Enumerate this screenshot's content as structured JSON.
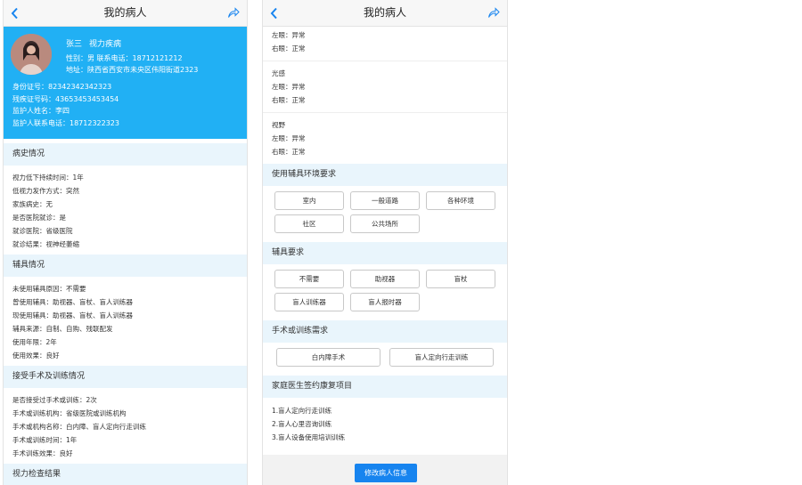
{
  "screen1": {
    "nav": {
      "title": "我的病人"
    },
    "profile": {
      "name": "张三",
      "disease": "视力疾病",
      "gender_line": "性别：男  联系电话：18712121212",
      "address_line": "地址：陕西省西安市未央区伟阳街道2323",
      "id_card": "身份证号：82342342342323",
      "disability_card": "残疾证号码：43653453453454",
      "guardian_name": "监护人姓名：李四",
      "guardian_phone": "监护人联系电话：18712322323"
    },
    "sections": {
      "history": {
        "title": "病史情况",
        "items": [
          "视力低下持续时间：1年",
          "低视力发作方式：突然",
          "家族病史：无",
          "是否医院就诊：是",
          "就诊医院：省级医院",
          "就诊结果：视神经萎缩"
        ]
      },
      "aids": {
        "title": "辅具情况",
        "items": [
          "未使用辅具原因：不需要",
          "曾使用辅具：助视器、盲杖、盲人训练器",
          "现使用辅具：助视器、盲杖、盲人训练器",
          "辅具来源：自制、自购、残联配发",
          "使用年限：2年",
          "使用效果：良好"
        ]
      },
      "surgery": {
        "title": "接受手术及训练情况",
        "items": [
          "是否接受过手术或训练：2次",
          "手术或训练机构：省级医院或训练机构",
          "手术或机构名称：白内障、盲人定向行走训练",
          "手术或训练时间：1年",
          "手术训练效果：良好"
        ]
      },
      "exam": {
        "title": "视力检查结果"
      }
    }
  },
  "screen2": {
    "nav": {
      "title": "我的病人"
    },
    "exam_groups": [
      {
        "items": [
          "左眼：异常",
          "右眼：正常"
        ]
      },
      {
        "label": "光感",
        "items": [
          "左眼：异常",
          "右眼：正常"
        ]
      },
      {
        "label": "视野",
        "items": [
          "左眼：异常",
          "右眼：正常"
        ]
      }
    ],
    "environment": {
      "title": "使用辅具环境要求",
      "options": [
        "室内",
        "一般道路",
        "各种环境",
        "社区",
        "公共场所"
      ]
    },
    "aid_requirements": {
      "title": "辅具要求",
      "options": [
        "不需要",
        "助视器",
        "盲杖",
        "盲人训练器",
        "盲人报时器"
      ]
    },
    "surgery_needs": {
      "title": "手术或训练需求",
      "options": [
        "白内障手术",
        "盲人定向行走训练"
      ]
    },
    "family_doctor": {
      "title": "家庭医生签约康复项目",
      "items": [
        "1.盲人定向行走训练",
        "2.盲人心里咨询训练",
        "3.盲人设备使用培训训练"
      ]
    },
    "edit_button": "修改病人信息"
  },
  "colors": {
    "accent": "#21b0f4",
    "button": "#1784ef",
    "section_bg": "#e9f5fc"
  },
  "icons": {
    "back": "chevron-left-icon",
    "share": "share-icon"
  }
}
